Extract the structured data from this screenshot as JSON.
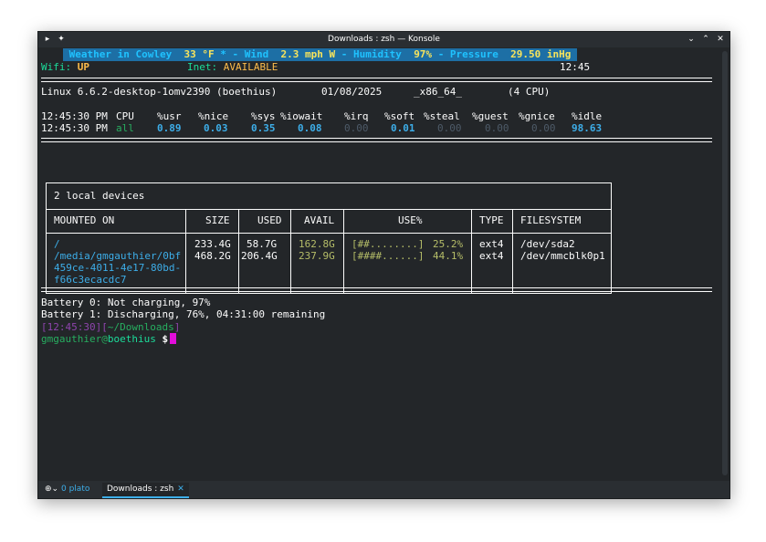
{
  "window": {
    "title": "Downloads : zsh — Konsole"
  },
  "status": {
    "weather_label": "Weather in Cowley",
    "temp": "33 °F",
    "sep1": "*",
    "wind_label": "- Wind",
    "wind": "2.3 mph W",
    "humidity_label": "- Humidity",
    "humidity": "97%",
    "pressure_label": "- Pressure",
    "pressure": "29.50 inHg",
    "wifi_label": "Wifi:",
    "wifi": "UP",
    "inet_label": "Inet:",
    "inet": "AVAILABLE",
    "clock": "12:45"
  },
  "sysinfo": {
    "kernel": "Linux 6.6.2-desktop-1omv2390 (boethius)",
    "date": "01/08/2025",
    "arch": "_x86_64_",
    "cpus": "(4 CPU)"
  },
  "cpu": {
    "headers": [
      "12:45:30 PM",
      "CPU",
      "%usr",
      "%nice",
      "%sys",
      "%iowait",
      "%irq",
      "%soft",
      "%steal",
      "%guest",
      "%gnice",
      "%idle"
    ],
    "row": [
      "12:45:30 PM",
      "all",
      "0.89",
      "0.03",
      "0.35",
      "0.08",
      "0.00",
      "0.01",
      "0.00",
      "0.00",
      "0.00",
      "98.63"
    ]
  },
  "disks": {
    "title": "2 local devices",
    "columns": [
      "MOUNTED ON",
      "SIZE",
      "USED",
      "AVAIL",
      "USE%",
      "TYPE",
      "FILESYSTEM"
    ],
    "rows": [
      {
        "mount": "/",
        "size": "233.4G",
        "used": "58.7G",
        "avail": "162.8G",
        "bar": "[##........]",
        "pct": "25.2%",
        "type": "ext4",
        "fs": "/dev/sda2"
      },
      {
        "mount": "/media/gmgauthier/0bf",
        "mount2": "459ce-4011-4e17-80bd-",
        "mount3": "f66c3ecacdc7",
        "size": "468.2G",
        "used": "206.4G",
        "avail": "237.9G",
        "bar": "[####......]",
        "pct": "44.1%",
        "type": "ext4",
        "fs": "/dev/mmcblk0p1"
      }
    ]
  },
  "battery": {
    "b0": "Battery 0: Not charging, 97%",
    "b1": "Battery 1: Discharging, 76%, 04:31:00 remaining"
  },
  "prompt": {
    "lbr": "[",
    "time": "12:45:30",
    "mid": "][",
    "dir": "~/Downloads",
    "rbr": "]",
    "user": "gmgauthier",
    "at": "@",
    "host": "boethius",
    "symbol": "$"
  },
  "tabs": [
    {
      "label": "0 plato"
    },
    {
      "label": "Downloads : zsh"
    }
  ],
  "colors": {
    "background": "#232629",
    "accent": "#3daee9",
    "cursor": "#e20ddb"
  }
}
